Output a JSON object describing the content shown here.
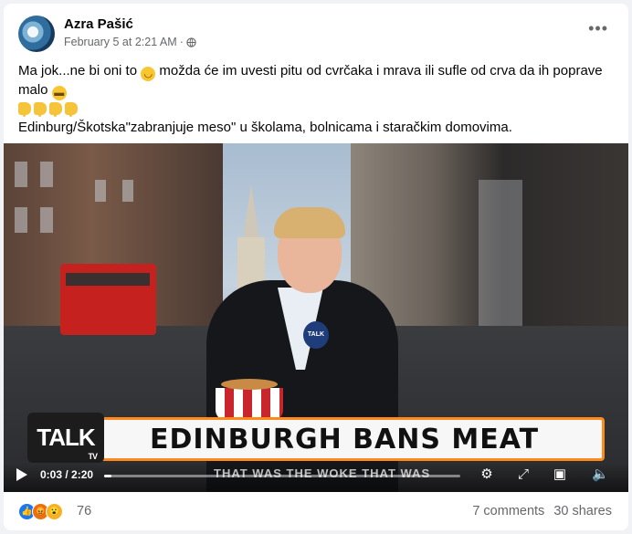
{
  "post": {
    "author": "Azra Pašić",
    "timestamp": "February 5 at 2:21 AM",
    "separator": "·",
    "audience_icon": "globe-icon",
    "more_label": "•••",
    "line1": "Ma jok...ne bi oni to",
    "line1b": "možda će im uvesti pitu od cvrčaka i mrava ili sufle od crva da ih poprave malo",
    "line3": "Edinburg/Škotska\"zabranjuje meso\" u školama,  bolnicama i staračkim domovima."
  },
  "video": {
    "channel_logo": "TALK",
    "channel_sub": "TV",
    "mic_label": "TALK",
    "headline": "EDINBURGH BANS MEAT",
    "ticker": "THAT WAS THE WOKE THAT WAS",
    "time": "0:03 / 2:20",
    "progress": 0.02,
    "icons": [
      "play-icon",
      "settings-icon",
      "fullscreen-icon",
      "picture-in-picture-icon",
      "mute-icon"
    ]
  },
  "footer": {
    "reaction_icons": [
      "like-icon",
      "angry-icon",
      "wow-icon"
    ],
    "reaction_count": "76",
    "comments": "7 comments",
    "shares": "30 shares"
  },
  "colors": {
    "accent_orange": "#ff8a1c",
    "like_blue": "#1877f2"
  }
}
